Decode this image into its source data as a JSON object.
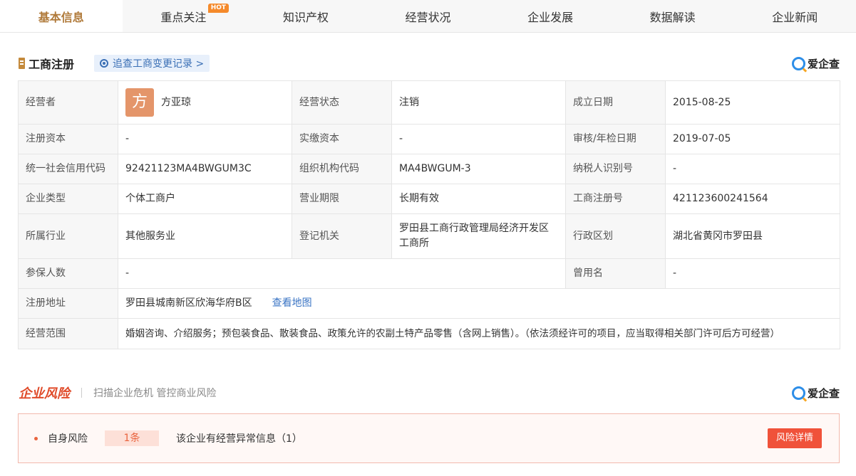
{
  "tabs": [
    {
      "label": "基本信息",
      "active": true
    },
    {
      "label": "重点关注",
      "badge": "HOT"
    },
    {
      "label": "知识产权"
    },
    {
      "label": "经营状况"
    },
    {
      "label": "企业发展"
    },
    {
      "label": "数据解读"
    },
    {
      "label": "企业新闻"
    }
  ],
  "registration": {
    "title": "工商注册",
    "trace_link": "追查工商变更记录 >",
    "brand": "爱企查"
  },
  "info": {
    "operator_label": "经营者",
    "operator_avatar_char": "方",
    "operator_name": "方亚琼",
    "status_label": "经营状态",
    "status_value": "注销",
    "founded_label": "成立日期",
    "founded_value": "2015-08-25",
    "reg_capital_label": "注册资本",
    "reg_capital_value": "-",
    "paid_capital_label": "实缴资本",
    "paid_capital_value": "-",
    "review_date_label": "审核/年检日期",
    "review_date_value": "2019-07-05",
    "credit_code_label": "统一社会信用代码",
    "credit_code_value": "92421123MA4BWGUM3C",
    "org_code_label": "组织机构代码",
    "org_code_value": "MA4BWGUM-3",
    "taxpayer_label": "纳税人识别号",
    "taxpayer_value": "-",
    "type_label": "企业类型",
    "type_value": "个体工商户",
    "term_label": "营业期限",
    "term_value": "长期有效",
    "reg_no_label": "工商注册号",
    "reg_no_value": "421123600241564",
    "industry_label": "所属行业",
    "industry_value": "其他服务业",
    "authority_label": "登记机关",
    "authority_value": "罗田县工商行政管理局经济开发区工商所",
    "region_label": "行政区划",
    "region_value": "湖北省黄冈市罗田县",
    "insured_label": "参保人数",
    "insured_value": "-",
    "former_name_label": "曾用名",
    "former_name_value": "-",
    "address_label": "注册地址",
    "address_value": "罗田县城南新区欣海华府B区",
    "map_link": "查看地图",
    "scope_label": "经营范围",
    "scope_value": "婚姻咨询、介绍服务；预包装食品、散装食品、政策允许的农副土特产品零售（含网上销售）。（依法须经许可的项目，应当取得相关部门许可后方可经营）"
  },
  "risk": {
    "title": "企业风险",
    "subtitle": "扫描企业危机 管控商业风险",
    "brand": "爱企查",
    "item_label": "自身风险",
    "item_count": "1条",
    "item_desc": "该企业有经营异常信息（1）",
    "detail_button": "风险详情"
  },
  "colors": {
    "accent": "#b07a3a",
    "link": "#3a74c4",
    "risk": "#f0523a"
  }
}
